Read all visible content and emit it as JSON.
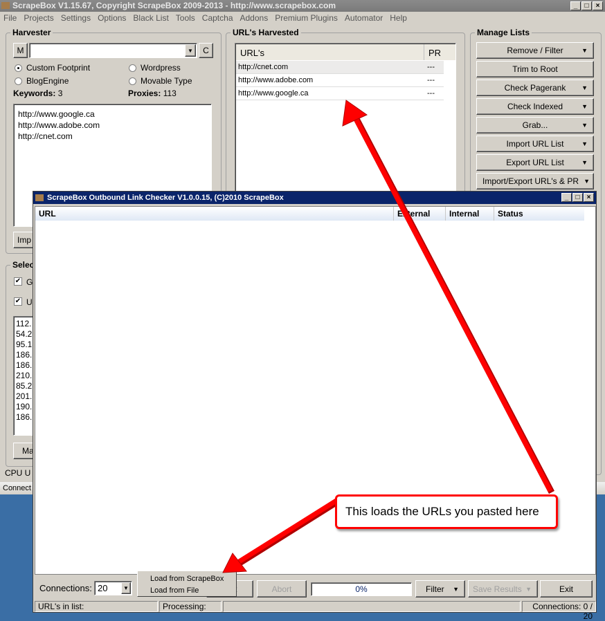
{
  "main": {
    "title": "ScrapeBox V1.15.67, Copyright ScrapeBox 2009-2013 - http://www.scrapebox.com",
    "menu": [
      "File",
      "Projects",
      "Settings",
      "Options",
      "Black List",
      "Tools",
      "Captcha",
      "Addons",
      "Premium Plugins",
      "Automator",
      "Help"
    ],
    "harvester": {
      "label": "Harvester",
      "m": "M",
      "c": "C",
      "footprint_value": "",
      "radios": [
        {
          "label": "Custom Footprint",
          "checked": true
        },
        {
          "label": "Wordpress",
          "checked": false
        },
        {
          "label": "BlogEngine",
          "checked": false
        },
        {
          "label": "Movable Type",
          "checked": false
        }
      ],
      "keywords_label": "Keywords:",
      "keywords_count": "3",
      "proxies_label": "Proxies:",
      "proxies_count": "113",
      "keywords": [
        "http://www.google.ca",
        "http://www.adobe.com",
        "http://cnet.com"
      ],
      "import_btn": "Imp"
    },
    "select": {
      "label": "Selec",
      "cb1": "G",
      "cb2": "U",
      "proxies": [
        "112.",
        "54.2",
        "95.1",
        "186.",
        "186.",
        "210.",
        "85.2",
        "201.",
        "190.",
        "186."
      ],
      "btn": "Ma"
    },
    "cpu": "CPU U",
    "status": "Connect",
    "harvested": {
      "label": "URL's Harvested",
      "col_url": "URL's",
      "col_pr": "PR",
      "rows": [
        {
          "url": "http://cnet.com",
          "pr": "---"
        },
        {
          "url": "http://www.adobe.com",
          "pr": "---"
        },
        {
          "url": "http://www.google.ca",
          "pr": "---"
        }
      ]
    },
    "manage": {
      "label": "Manage Lists",
      "buttons": [
        {
          "label": "Remove / Filter",
          "dropdown": true
        },
        {
          "label": "Trim to Root",
          "dropdown": false
        },
        {
          "label": "Check Pagerank",
          "dropdown": true
        },
        {
          "label": "Check Indexed",
          "dropdown": true
        },
        {
          "label": "Grab...",
          "dropdown": true
        },
        {
          "label": "Import URL List",
          "dropdown": true
        },
        {
          "label": "Export URL List",
          "dropdown": true
        },
        {
          "label": "Import/Export URL's & PR",
          "dropdown": true
        }
      ]
    }
  },
  "dialog": {
    "title": "ScrapeBox Outbound Link Checker V1.0.0.15, (C)2010 ScrapeBox",
    "columns": [
      "URL",
      "External",
      "Internal",
      "Status"
    ],
    "connections_label": "Connections:",
    "connections_value": "20",
    "menu": [
      "Load from ScrapeBox",
      "Load from File"
    ],
    "start_btn": "t",
    "abort_btn": "Abort",
    "progress": "0%",
    "progress_value": 0,
    "filter_btn": "Filter",
    "save_btn": "Save Results",
    "exit_btn": "Exit",
    "status": {
      "urls": "URL's in list:",
      "processing": "Processing:",
      "connections": "Connections: 0 / 20"
    }
  },
  "callout": {
    "text": "This loads the URLs you pasted here",
    "color": "#ff0000"
  }
}
